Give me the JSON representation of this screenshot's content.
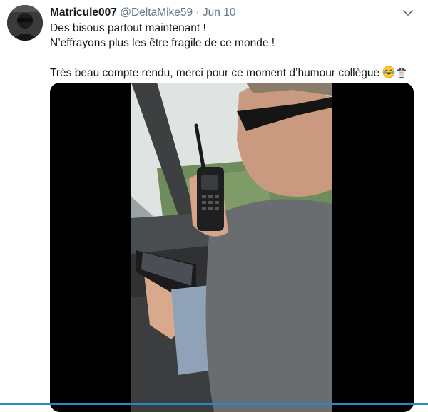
{
  "tweet": {
    "display_name": "Matricule007",
    "handle": "@DeltaMike59",
    "separator": "·",
    "date": "Jun 10",
    "lines": [
      "Des bisous partout maintenant !",
      "N’effrayons plus les être fragile de ce monde !",
      "Très beau compte rendu, merci pour ce moment d’humour collègue"
    ]
  },
  "icons": {
    "menu": "chevron-down-icon",
    "emoji_1": "face-with-tears-of-joy-icon",
    "emoji_2": "police-officer-icon"
  },
  "colors": {
    "text": "#14171a",
    "secondary": "#657786",
    "media_bg": "#000000"
  }
}
